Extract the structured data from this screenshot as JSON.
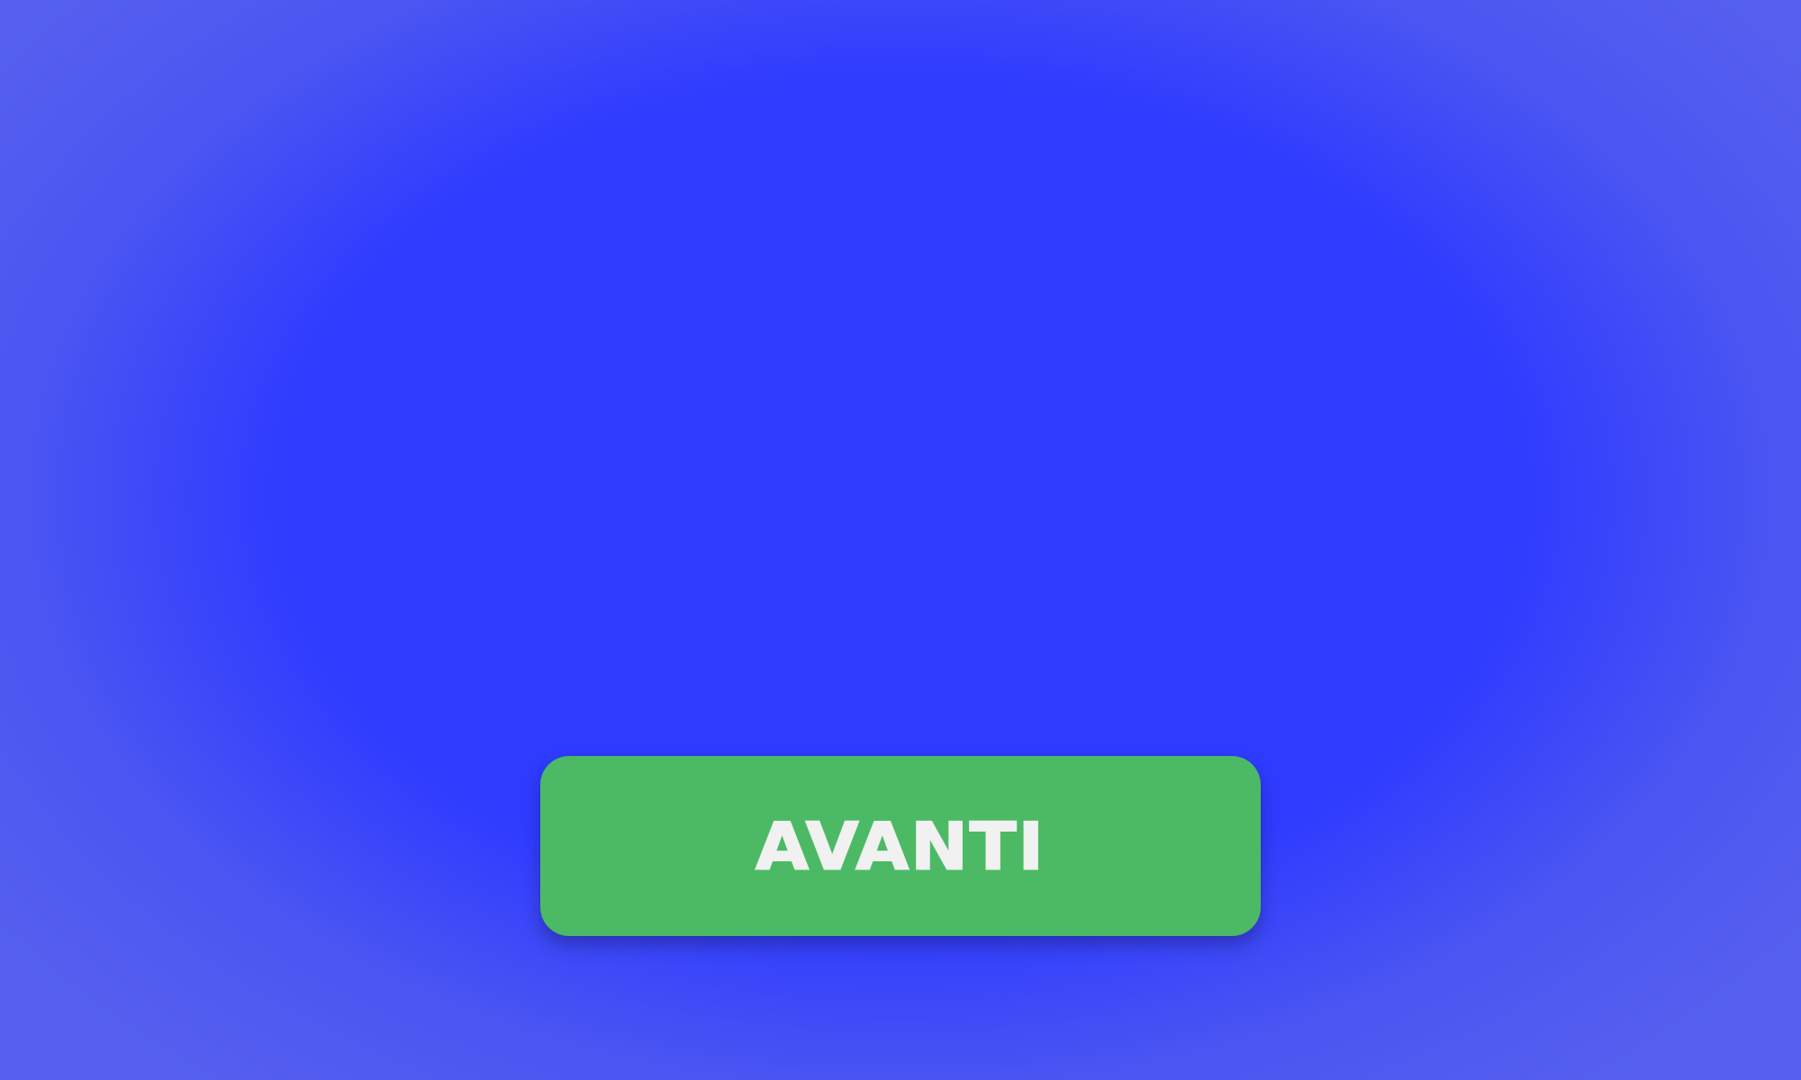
{
  "colors": {
    "background_center": "#2f3bff",
    "background_edge": "#5560ef",
    "button_fill": "#4cba65",
    "button_text": "#f1f1f1"
  },
  "primary_button": {
    "label": "AVANTI"
  }
}
